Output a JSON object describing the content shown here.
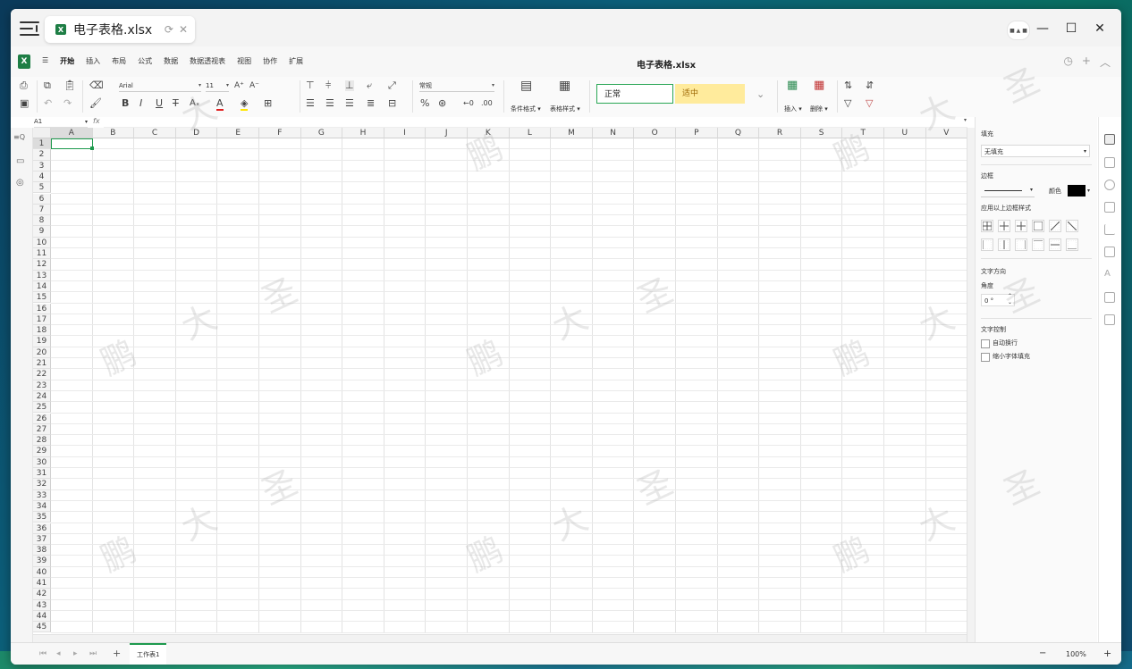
{
  "titlebar": {
    "tab_title": "电子表格.xlsx",
    "xlsx_badge": "X",
    "avatar_text": "■ ▲ ■"
  },
  "menubar": {
    "logo": "X",
    "hamburger": "☰",
    "items": [
      "开始",
      "插入",
      "布局",
      "公式",
      "数据",
      "数据透视表",
      "视图",
      "协作",
      "扩展"
    ],
    "active": "开始",
    "doc_title": "电子表格.xlsx"
  },
  "toolbar": {
    "font_name": "Arial",
    "font_size": "11",
    "number_format": "常规",
    "conditional_format": "条件格式 ▾",
    "table_style": "表格样式 ▾",
    "style_normal": "正常",
    "style_neutral": "适中",
    "insert": "插入 ▾",
    "delete": "删除 ▾"
  },
  "formula": {
    "cell_ref": "A1",
    "fx": "fx"
  },
  "grid": {
    "columns": [
      "A",
      "B",
      "C",
      "D",
      "E",
      "F",
      "G",
      "H",
      "I",
      "J",
      "K",
      "L",
      "M",
      "N",
      "O",
      "P",
      "Q",
      "R",
      "S",
      "T",
      "U",
      "V"
    ],
    "rows": [
      "1",
      "2",
      "3",
      "4",
      "5",
      "6",
      "7",
      "8",
      "9",
      "10",
      "11",
      "12",
      "13",
      "14",
      "15",
      "16",
      "17",
      "18",
      "19",
      "20",
      "21",
      "22",
      "23",
      "24",
      "25",
      "26",
      "27",
      "28",
      "29",
      "30",
      "31",
      "32",
      "33",
      "34",
      "35",
      "36",
      "37",
      "38",
      "39",
      "40",
      "41",
      "42",
      "43",
      "44",
      "45"
    ],
    "selected_cell": "A1"
  },
  "right_panel": {
    "fill_label": "填充",
    "fill_value": "无填充",
    "border_label": "边框",
    "color_label": "颜色",
    "border_color": "#000000",
    "apply_border_label": "应用以上边框样式",
    "text_direction_label": "文字方向",
    "angle_label": "角度",
    "angle_value": "0 °",
    "text_control_label": "文字控制",
    "wrap_text": "自动换行",
    "shrink_to_fit": "缩小字体填充"
  },
  "statusbar": {
    "sheet_name": "工作表1",
    "add_sheet": "+",
    "zoom_minus": "−",
    "zoom_value": "100%",
    "zoom_plus": "+"
  },
  "watermark": {
    "chars": [
      "鹏",
      "大",
      "圣"
    ]
  },
  "colors": {
    "accent_green": "#1e9a4e",
    "style_normal_border": "#2aa655",
    "style_neutral_bg": "#ffeb9c",
    "style_neutral_text": "#9c6500"
  }
}
